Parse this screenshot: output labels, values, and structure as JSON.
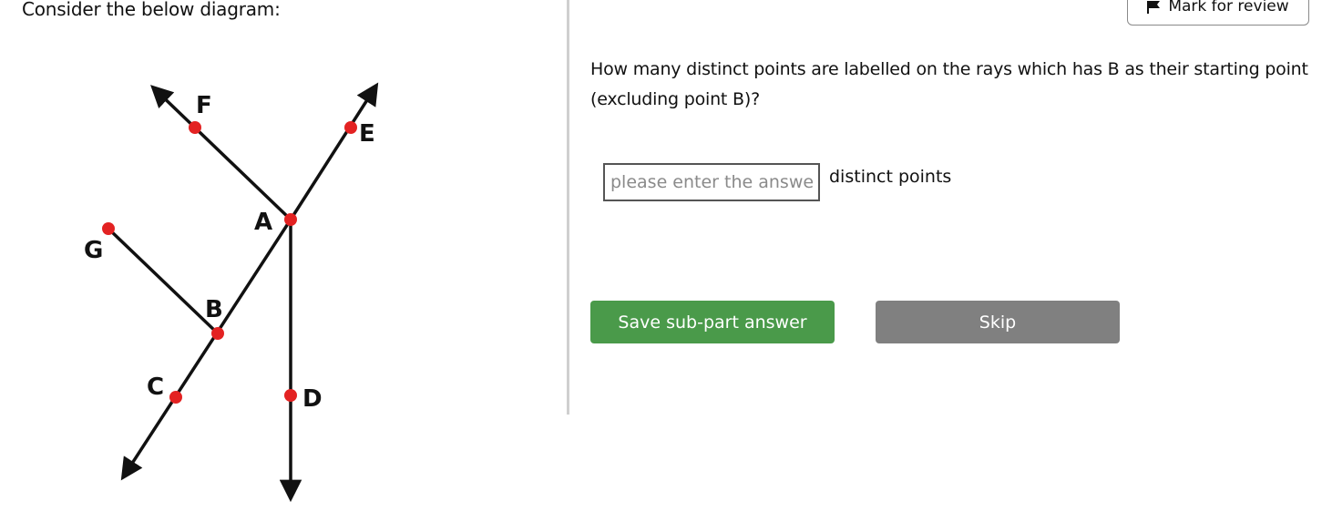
{
  "left": {
    "prompt": "Consider the below diagram:"
  },
  "diagram": {
    "points": [
      "A",
      "B",
      "C",
      "D",
      "E",
      "F",
      "G"
    ],
    "labels": {
      "A": "A",
      "B": "B",
      "C": "C",
      "D": "D",
      "E": "E",
      "F": "F",
      "G": "G"
    },
    "colors": {
      "point": "#e32222",
      "line": "#111111"
    }
  },
  "header": {
    "mark_review_label": "Mark for review"
  },
  "question": {
    "text": "How many distinct points are labelled on the rays which has B as their starting point (excluding point B)?"
  },
  "answer": {
    "value": "",
    "placeholder": "please enter the answer",
    "unit_label": "distinct points"
  },
  "actions": {
    "save_label": "Save sub-part answer",
    "skip_label": "Skip"
  },
  "colors": {
    "save_button": "#4a9a4a",
    "skip_button": "#808080",
    "divider": "#cfcfcf"
  }
}
